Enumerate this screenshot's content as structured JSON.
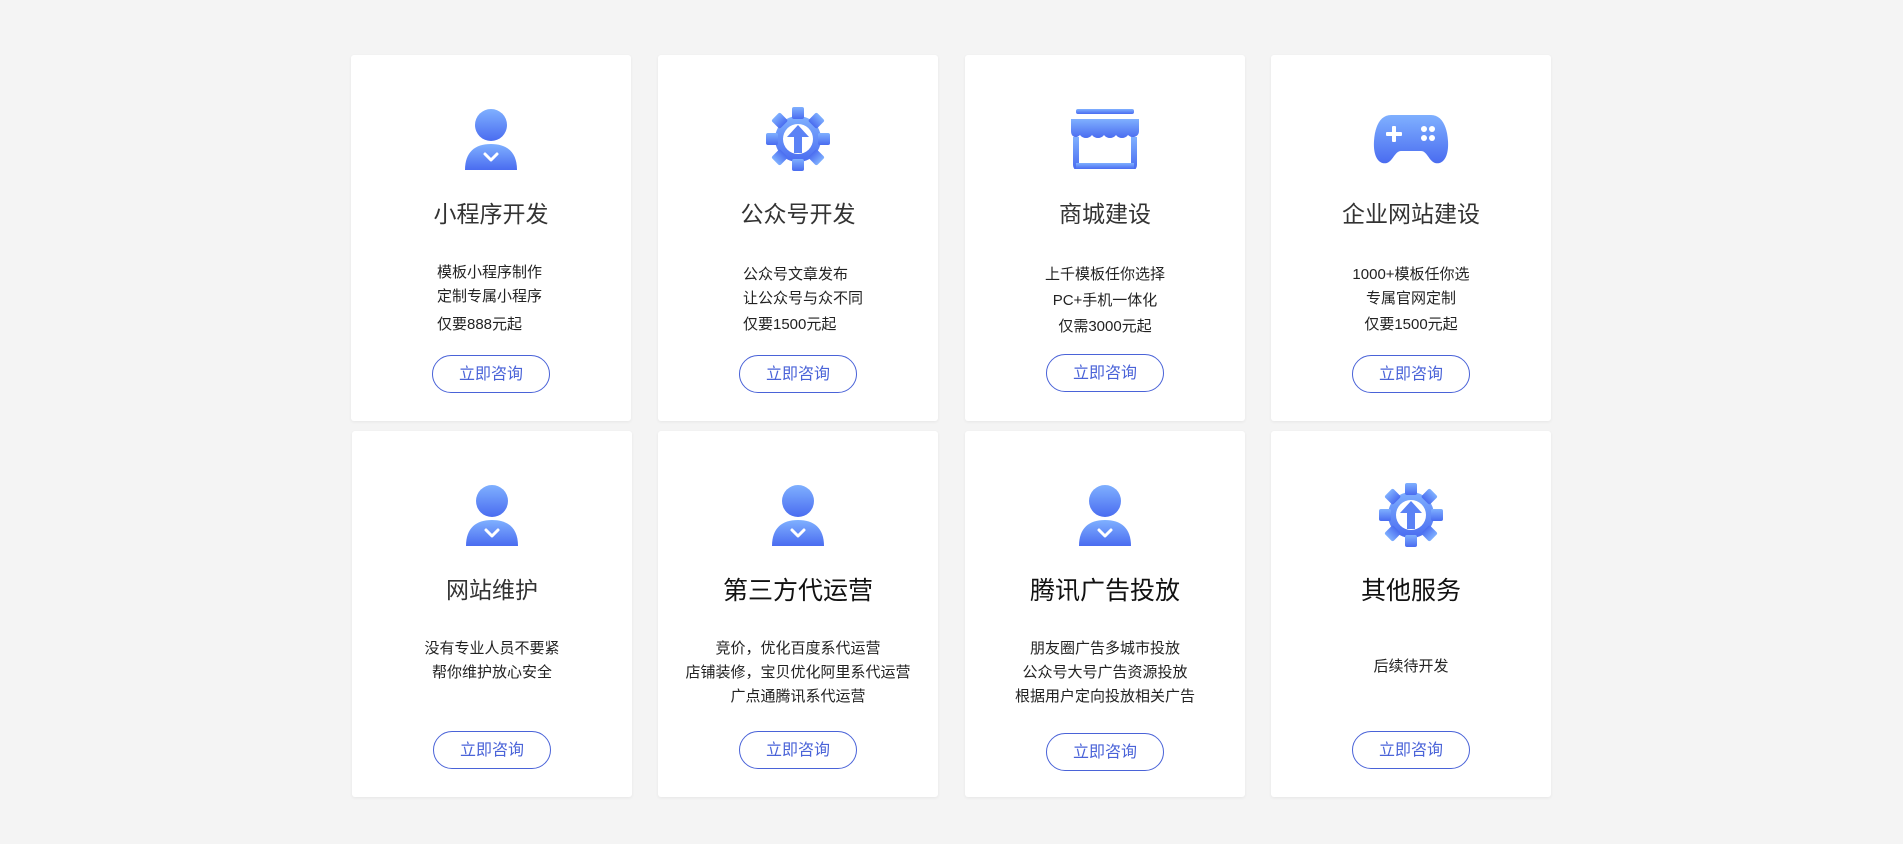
{
  "accent_color": "#4a63d8",
  "icon_gradient": [
    "#7fb0ff",
    "#4a6cf0"
  ],
  "cards": [
    {
      "icon": "user-icon",
      "title": "小程序开发",
      "lines": [
        "模板小程序制作",
        "定制专属小程序",
        "仅要888元起"
      ],
      "button": "立即咨询"
    },
    {
      "icon": "gear-upload-icon",
      "title": "公众号开发",
      "lines": [
        "公众号文章发布",
        "让公众号与众不同",
        "仅要1500元起"
      ],
      "button": "立即咨询"
    },
    {
      "icon": "store-icon",
      "title": "商城建设",
      "lines": [
        "上千模板任你选择",
        "PC+手机一体化",
        "仅需3000元起"
      ],
      "button": "立即咨询"
    },
    {
      "icon": "gamepad-icon",
      "title": "企业网站建设",
      "lines": [
        "1000+模板任你选",
        "专属官网定制",
        "仅要1500元起"
      ],
      "button": "立即咨询"
    },
    {
      "icon": "user-icon",
      "title": "网站维护",
      "lines": [
        "没有专业人员不要紧",
        "帮你维护放心安全"
      ],
      "button": "立即咨询"
    },
    {
      "icon": "user-icon",
      "title": "第三方代运营",
      "lines": [
        "竞价，优化百度系代运营",
        "店铺装修，宝贝优化阿里系代运营",
        "广点通腾讯系代运营"
      ],
      "button": "立即咨询"
    },
    {
      "icon": "user-icon",
      "title": "腾讯广告投放",
      "lines": [
        "朋友圈广告多城市投放",
        "公众号大号广告资源投放",
        "根据用户定向投放相关广告"
      ],
      "button": "立即咨询"
    },
    {
      "icon": "gear-upload-icon",
      "title": "其他服务",
      "lines": [
        "后续待开发"
      ],
      "button": "立即咨询"
    }
  ]
}
